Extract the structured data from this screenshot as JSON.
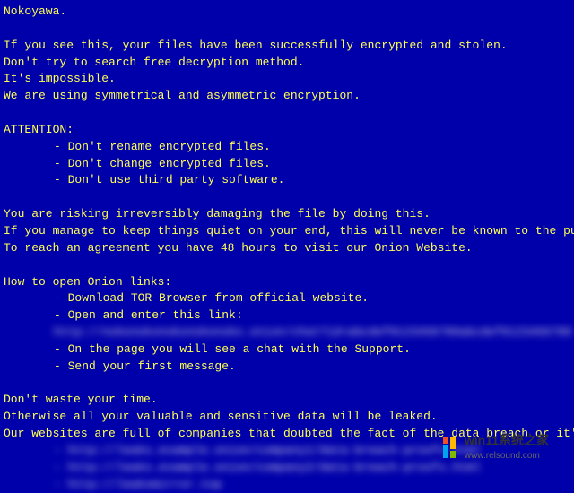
{
  "note": {
    "title": "Nokoyawa.",
    "p1_l1": "If you see this, your files have been successfully encrypted and stolen.",
    "p1_l2": "Don't try to search free decryption method.",
    "p1_l3": "It's impossible.",
    "p1_l4": "We are using symmetrical and asymmetric encryption.",
    "attention_header": "ATTENTION:",
    "att_1": "- Don't rename encrypted files.",
    "att_2": "- Don't change encrypted files.",
    "att_3": "- Don't use third party software.",
    "p2_l1": "You are risking irreversibly damaging the file by doing this.",
    "p2_l2": "If you manage to keep things quiet on your end, this will never be known to the public.",
    "p2_l3": "To reach an agreement you have 48 hours to visit our Onion Website.",
    "howto_header": "How to open Onion links:",
    "howto_1": "- Download TOR Browser from official website.",
    "howto_2": "- Open and enter this link:",
    "howto_blur_link": "http://nokonokonokonokonoko.onion/chat?id=abcdef0123456789abcdef0123456789",
    "howto_3": "- On the page you will see a chat with the Support.",
    "howto_4": "- Send your first message.",
    "p3_l1": "Don't waste your time.",
    "p3_l2": "Otherwise all your valuable and sensitive data will be leaked.",
    "p3_l3": "Our websites are full of companies that doubted the fact of the data breach or it's extent",
    "leak_blur_1": "- http://leaks.example.onion/company1/data-breach-proofs.html",
    "leak_blur_2": "- http://leaks.example.onion/company2/data-breach-proofs.html",
    "leak_blur_3": "- http://leaksmirror.top"
  },
  "watermark": {
    "title": "win11系统之家",
    "subtitle": "www.relsound.com",
    "colors": {
      "red": "#F25022",
      "orange": "#FFB900",
      "green": "#7FBA00",
      "blue": "#00A4EF"
    }
  }
}
